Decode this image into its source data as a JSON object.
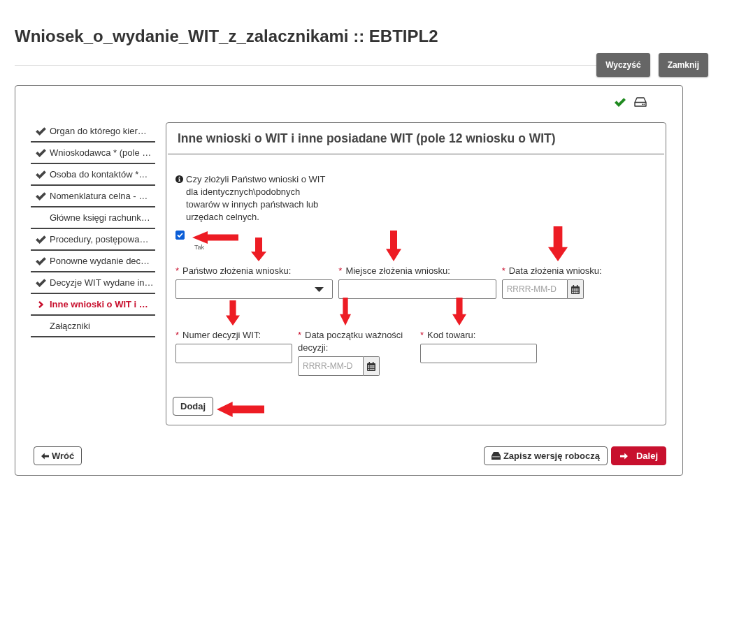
{
  "page": {
    "title": "Wniosek_o_wydanie_WIT_z_zalacznikami :: EBTIPL2",
    "actions": [
      {
        "label": "Wyczyść"
      },
      {
        "label": "Zamknij"
      }
    ]
  },
  "sidebar": {
    "items": [
      {
        "label": "Organ do którego kier…",
        "completed": true,
        "selected": false
      },
      {
        "label": "Wnioskodawca * (pole …",
        "completed": true,
        "selected": false
      },
      {
        "label": "Osoba do kontaktów *…",
        "completed": true,
        "selected": false
      },
      {
        "label": "Nomenklatura celna - …",
        "completed": true,
        "selected": false
      },
      {
        "label": "Główne księgi rachunk…",
        "completed": false,
        "selected": false
      },
      {
        "label": "Procedury, postępowa…",
        "completed": true,
        "selected": false
      },
      {
        "label": "Ponowne wydanie dec…",
        "completed": true,
        "selected": false
      },
      {
        "label": "Decyzje WIT wydane in…",
        "completed": true,
        "selected": false
      },
      {
        "label": "Inne wnioski o WIT i …",
        "completed": false,
        "selected": true
      },
      {
        "label": "Załączniki",
        "completed": false,
        "selected": false
      }
    ]
  },
  "panel": {
    "title": "Inne wnioski o WIT i inne posiadane WIT (pole 12 wniosku o WIT)",
    "question": {
      "text": "Czy złożyli Państwo wnioski o WIT dla identycznych\\podobnych towarów w innych państwach lub urzędach celnych.",
      "checked": true,
      "option_label": "Tak",
      "annotated": true
    },
    "rows": [
      [
        {
          "kind": "select",
          "marker": "*",
          "label": "Państwo złożenia wniosku:",
          "annotated": true
        },
        {
          "kind": "text",
          "marker": "*",
          "label": "Miejsce złożenia wniosku:",
          "annotated": true
        },
        {
          "kind": "date",
          "marker": "*",
          "label": "Data złożenia wniosku:",
          "placeholder": "RRRR-MM-D",
          "annotated": true
        }
      ],
      [
        {
          "kind": "text",
          "marker": "*",
          "label": "Numer decyzji WIT:",
          "annotated": true
        },
        {
          "kind": "date",
          "marker": "*",
          "label": "Data początku ważności decyzji:",
          "placeholder": "RRRR-MM-D",
          "annotated": true
        },
        {
          "kind": "text",
          "marker": "*",
          "label": "Kod towaru:",
          "annotated": true
        }
      ]
    ],
    "add_button": {
      "label": "Dodaj",
      "annotated": true
    }
  },
  "footer": {
    "back_button": "Wróć",
    "save_button": "Zapisz wersję roboczą",
    "next_button": "Dalej"
  }
}
